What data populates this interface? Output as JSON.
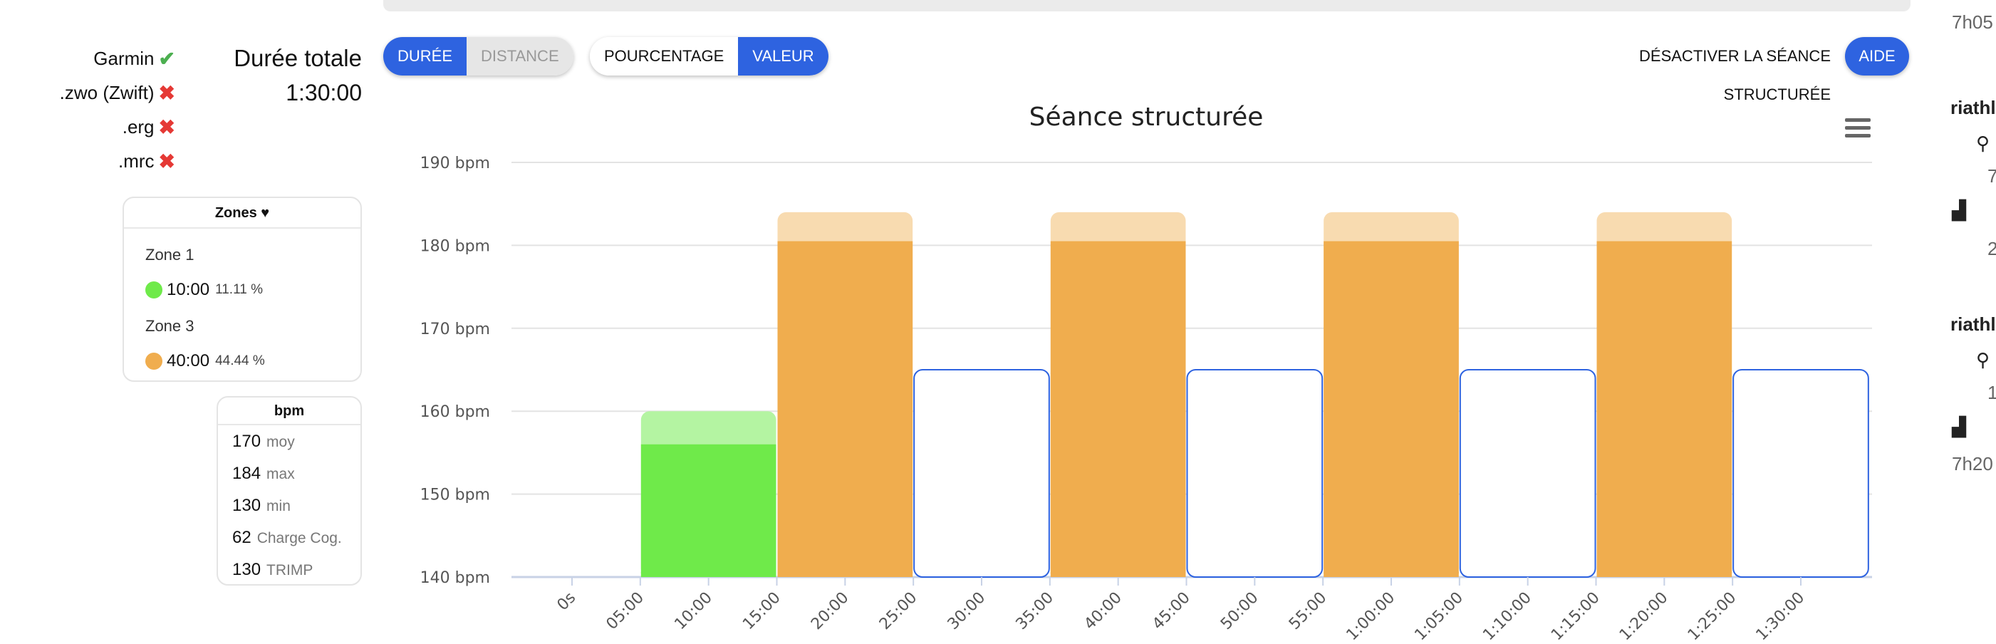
{
  "exports": [
    {
      "label": "Garmin",
      "status": "ok"
    },
    {
      "label": ".zwo (Zwift)",
      "status": "ko"
    },
    {
      "label": ".erg",
      "status": "ko"
    },
    {
      "label": ".mrc",
      "status": "ko"
    }
  ],
  "total": {
    "label": "Durée totale",
    "value": "1:30:00"
  },
  "zones_card": {
    "title": "Zones",
    "zones": [
      {
        "name": "Zone 1",
        "time": "10:00",
        "pct": "11.11 %",
        "color": "#6fea4a"
      },
      {
        "name": "Zone 3",
        "time": "40:00",
        "pct": "44.44 %",
        "color": "#f0ad4e"
      }
    ]
  },
  "bpm_card": {
    "title": "bpm",
    "stats": [
      {
        "value": "170",
        "key": "moy"
      },
      {
        "value": "184",
        "key": "max"
      },
      {
        "value": "130",
        "key": "min"
      },
      {
        "value": "62",
        "key": "Charge Cog."
      },
      {
        "value": "130",
        "key": "TRIMP"
      }
    ]
  },
  "toggles": {
    "mode": {
      "options": [
        "DURÉE",
        "DISTANCE"
      ],
      "active": "DURÉE"
    },
    "unit": {
      "options": [
        "POURCENTAGE",
        "VALEUR"
      ],
      "active": "VALEUR"
    }
  },
  "actions": {
    "deactivate": "DÉSACTIVER LA SÉANCE STRUCTURÉE",
    "help": "AIDE"
  },
  "colors": {
    "accent": "#2e63e0",
    "zone1": "#6fea4a",
    "zone3": "#f0ad4e",
    "rest_border": "#2e63e0"
  },
  "right_panel": {
    "texts": [
      "7h05 -",
      "riathlo",
      "7",
      "2",
      "riathl",
      "1",
      "7h20 -"
    ]
  },
  "chart_data": {
    "type": "bar",
    "title": "Séance structurée",
    "ylim": [
      140,
      190
    ],
    "yticks": [
      "140 bpm",
      "150 bpm",
      "160 bpm",
      "170 bpm",
      "180 bpm",
      "190 bpm"
    ],
    "ytick_values": [
      140,
      150,
      160,
      170,
      180,
      190
    ],
    "xlim": [
      0,
      90
    ],
    "xticks": [
      "0s",
      "05:00",
      "10:00",
      "15:00",
      "20:00",
      "25:00",
      "30:00",
      "35:00",
      "40:00",
      "45:00",
      "50:00",
      "55:00",
      "1:00:00",
      "1:05:00",
      "1:10:00",
      "1:15:00",
      "1:20:00",
      "1:25:00",
      "1:30:00"
    ],
    "grid": true,
    "segments": [
      {
        "start": 5,
        "end": 15,
        "low": 156,
        "high": 160,
        "kind": "zone1"
      },
      {
        "start": 15,
        "end": 25,
        "low": 180.5,
        "high": 184,
        "kind": "zone3"
      },
      {
        "start": 25,
        "end": 35,
        "low": 165,
        "high": 165,
        "kind": "rest"
      },
      {
        "start": 35,
        "end": 45,
        "low": 180.5,
        "high": 184,
        "kind": "zone3"
      },
      {
        "start": 45,
        "end": 55,
        "low": 165,
        "high": 165,
        "kind": "rest"
      },
      {
        "start": 55,
        "end": 65,
        "low": 180.5,
        "high": 184,
        "kind": "zone3"
      },
      {
        "start": 65,
        "end": 75,
        "low": 165,
        "high": 165,
        "kind": "rest"
      },
      {
        "start": 75,
        "end": 85,
        "low": 180.5,
        "high": 184,
        "kind": "zone3"
      },
      {
        "start": 85,
        "end": 95,
        "low": 165,
        "high": 165,
        "kind": "rest"
      }
    ]
  }
}
